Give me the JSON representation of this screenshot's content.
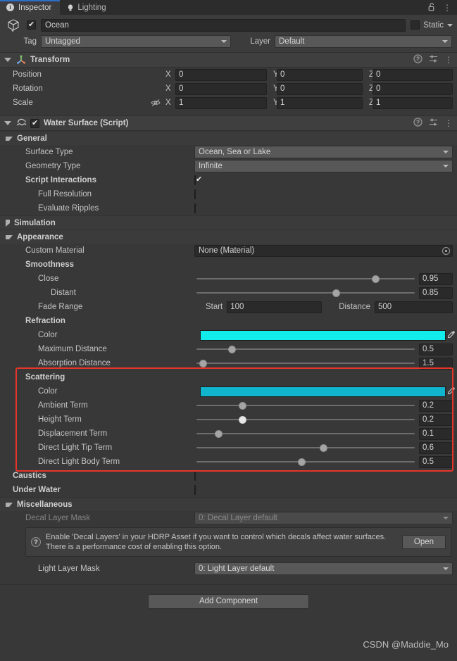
{
  "window": {
    "tabs": [
      {
        "label": "Inspector",
        "icon": "info-icon",
        "active": true
      },
      {
        "label": "Lighting",
        "icon": "lightbulb-icon",
        "active": false
      }
    ],
    "lock_icon": "lock-open-icon",
    "menu_icon": "kebab-menu-icon"
  },
  "gameobject": {
    "enabled": true,
    "name": "Ocean",
    "static_label": "Static",
    "tag_label": "Tag",
    "tag_value": "Untagged",
    "layer_label": "Layer",
    "layer_value": "Default"
  },
  "transform": {
    "title": "Transform",
    "expanded": true,
    "rows": [
      {
        "label": "Position",
        "x": "0",
        "y": "0",
        "z": "0",
        "lock": false
      },
      {
        "label": "Rotation",
        "x": "0",
        "y": "0",
        "z": "0",
        "lock": false
      },
      {
        "label": "Scale",
        "x": "1",
        "y": "1",
        "z": "1",
        "lock": true
      }
    ],
    "axis_x": "X",
    "axis_y": "Y",
    "axis_z": "Z"
  },
  "water_surface": {
    "title": "Water Surface (Script)",
    "enabled": true,
    "general": {
      "header": "General",
      "surface_type_label": "Surface Type",
      "surface_type_value": "Ocean, Sea or Lake",
      "geometry_type_label": "Geometry Type",
      "geometry_type_value": "Infinite",
      "script_interactions_label": "Script Interactions",
      "script_interactions_value": true,
      "full_resolution_label": "Full Resolution",
      "full_resolution_value": false,
      "evaluate_ripples_label": "Evaluate Ripples",
      "evaluate_ripples_value": false
    },
    "simulation": {
      "header": "Simulation",
      "expanded": false
    },
    "appearance": {
      "header": "Appearance",
      "custom_material_label": "Custom Material",
      "custom_material_value": "None (Material)",
      "smoothness_label": "Smoothness",
      "close_label": "Close",
      "close_value": "0.95",
      "close_pct": 82,
      "distant_label": "Distant",
      "distant_value": "0.85",
      "distant_pct": 64,
      "fade_range_label": "Fade Range",
      "fade_start_label": "Start",
      "fade_start_value": "100",
      "fade_distance_label": "Distance",
      "fade_distance_value": "500",
      "refraction_label": "Refraction",
      "refraction_color_label": "Color",
      "refraction_color": "#12EDEC",
      "max_distance_label": "Maximum Distance",
      "max_distance_value": "0.5",
      "max_distance_pct": 16,
      "absorption_label": "Absorption Distance",
      "absorption_value": "1.5",
      "absorption_pct": 3
    },
    "scattering": {
      "header": "Scattering",
      "color_label": "Color",
      "color": "#11B4CD",
      "rows": [
        {
          "label": "Ambient Term",
          "value": "0.2",
          "pct": 21,
          "light_knob": false
        },
        {
          "label": "Height Term",
          "value": "0.2",
          "pct": 21,
          "light_knob": true
        },
        {
          "label": "Displacement Term",
          "value": "0.1",
          "pct": 10,
          "light_knob": false
        },
        {
          "label": "Direct Light Tip Term",
          "value": "0.6",
          "pct": 58,
          "light_knob": false
        },
        {
          "label": "Direct Light Body Term",
          "value": "0.5",
          "pct": 48,
          "light_knob": false
        }
      ],
      "highlight_color": "#E8352A"
    },
    "caustics": {
      "label": "Caustics",
      "value": false
    },
    "under_water": {
      "label": "Under Water",
      "value": false
    },
    "miscellaneous": {
      "header": "Miscellaneous",
      "decal_layer_mask_label": "Decal Layer Mask",
      "decal_layer_mask_value": "0: Decal Layer default",
      "help_text": "Enable 'Decal Layers' in your HDRP Asset if you want to control which decals affect water surfaces. There is a performance cost of enabling this option.",
      "open_button": "Open",
      "light_layer_mask_label": "Light Layer Mask",
      "light_layer_mask_value": "0: Light Layer default"
    }
  },
  "footer": {
    "add_component": "Add Component",
    "watermark": "CSDN @Maddie_Mo"
  }
}
